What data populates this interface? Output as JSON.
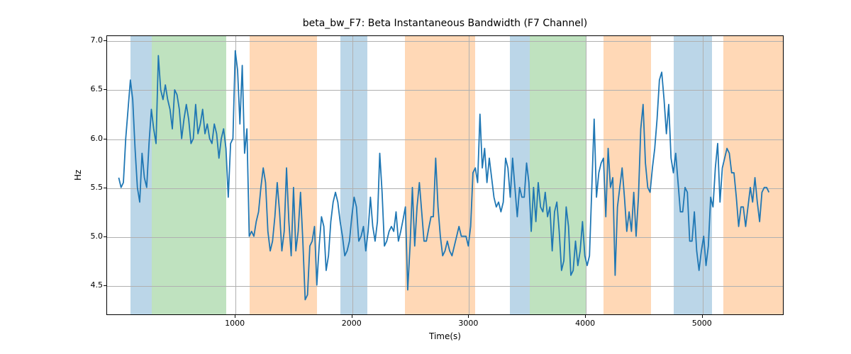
{
  "chart_data": {
    "type": "line",
    "title": "beta_bw_F7: Beta Instantaneous Bandwidth (F7 Channel)",
    "xlabel": "Time(s)",
    "ylabel": "Hz",
    "xlim": [
      -100,
      5700
    ],
    "ylim": [
      4.2,
      7.05
    ],
    "xticks": [
      1000,
      2000,
      3000,
      4000,
      5000
    ],
    "yticks": [
      4.5,
      5.0,
      5.5,
      6.0,
      6.5,
      7.0
    ],
    "background_spans": [
      {
        "x0": 100,
        "x1": 280,
        "color": "#1f77b4"
      },
      {
        "x0": 280,
        "x1": 920,
        "color": "#2ca02c"
      },
      {
        "x0": 1120,
        "x1": 1700,
        "color": "#ff7f0e"
      },
      {
        "x0": 1900,
        "x1": 2130,
        "color": "#1f77b4"
      },
      {
        "x0": 2450,
        "x1": 3050,
        "color": "#ff7f0e"
      },
      {
        "x0": 3350,
        "x1": 3520,
        "color": "#1f77b4"
      },
      {
        "x0": 3520,
        "x1": 4000,
        "color": "#2ca02c"
      },
      {
        "x0": 4150,
        "x1": 4560,
        "color": "#ff7f0e"
      },
      {
        "x0": 4750,
        "x1": 5080,
        "color": "#1f77b4"
      },
      {
        "x0": 5180,
        "x1": 5700,
        "color": "#ff7f0e"
      }
    ],
    "series": [
      {
        "name": "beta_bw_F7",
        "color": "#1f77b4",
        "x": [
          0,
          20,
          40,
          60,
          80,
          100,
          120,
          140,
          160,
          180,
          200,
          220,
          240,
          260,
          280,
          300,
          320,
          340,
          360,
          380,
          400,
          420,
          440,
          460,
          480,
          500,
          520,
          540,
          560,
          580,
          600,
          620,
          640,
          660,
          680,
          700,
          720,
          740,
          760,
          780,
          800,
          820,
          840,
          860,
          880,
          900,
          920,
          940,
          960,
          980,
          1000,
          1020,
          1040,
          1060,
          1080,
          1100,
          1120,
          1140,
          1160,
          1180,
          1200,
          1220,
          1240,
          1260,
          1280,
          1300,
          1320,
          1340,
          1360,
          1380,
          1400,
          1420,
          1440,
          1460,
          1480,
          1500,
          1520,
          1540,
          1560,
          1580,
          1600,
          1620,
          1640,
          1660,
          1680,
          1700,
          1720,
          1740,
          1760,
          1780,
          1800,
          1820,
          1840,
          1860,
          1880,
          1900,
          1920,
          1940,
          1960,
          1980,
          2000,
          2020,
          2040,
          2060,
          2080,
          2100,
          2120,
          2140,
          2160,
          2180,
          2200,
          2220,
          2240,
          2260,
          2280,
          2300,
          2320,
          2340,
          2360,
          2380,
          2400,
          2420,
          2440,
          2460,
          2480,
          2500,
          2520,
          2540,
          2560,
          2580,
          2600,
          2620,
          2640,
          2660,
          2680,
          2700,
          2720,
          2740,
          2760,
          2780,
          2800,
          2820,
          2840,
          2860,
          2880,
          2900,
          2920,
          2940,
          2960,
          2980,
          3000,
          3020,
          3040,
          3060,
          3080,
          3100,
          3120,
          3140,
          3160,
          3180,
          3200,
          3220,
          3240,
          3260,
          3280,
          3300,
          3320,
          3340,
          3360,
          3380,
          3400,
          3420,
          3440,
          3460,
          3480,
          3500,
          3520,
          3540,
          3560,
          3580,
          3600,
          3620,
          3640,
          3660,
          3680,
          3700,
          3720,
          3740,
          3760,
          3780,
          3800,
          3820,
          3840,
          3860,
          3880,
          3900,
          3920,
          3940,
          3960,
          3980,
          4000,
          4020,
          4040,
          4060,
          4080,
          4100,
          4120,
          4140,
          4160,
          4180,
          4200,
          4220,
          4240,
          4260,
          4280,
          4300,
          4320,
          4340,
          4360,
          4380,
          4400,
          4420,
          4440,
          4460,
          4480,
          4500,
          4520,
          4540,
          4560,
          4580,
          4600,
          4620,
          4640,
          4660,
          4680,
          4700,
          4720,
          4740,
          4760,
          4780,
          4800,
          4820,
          4840,
          4860,
          4880,
          4900,
          4920,
          4940,
          4960,
          4980,
          5000,
          5020,
          5040,
          5060,
          5080,
          5100,
          5120,
          5140,
          5160,
          5180,
          5200,
          5220,
          5240,
          5260,
          5280,
          5300,
          5320,
          5340,
          5360,
          5380,
          5400,
          5420,
          5440,
          5460,
          5480,
          5500,
          5520,
          5540,
          5560,
          5580,
          5600
        ],
        "y": [
          5.6,
          5.5,
          5.55,
          6.0,
          6.3,
          6.6,
          6.4,
          5.9,
          5.5,
          5.35,
          5.85,
          5.6,
          5.5,
          5.95,
          6.3,
          6.1,
          5.95,
          6.85,
          6.5,
          6.4,
          6.55,
          6.4,
          6.3,
          6.1,
          6.5,
          6.45,
          6.3,
          6.0,
          6.2,
          6.35,
          6.2,
          5.95,
          6.0,
          6.35,
          6.05,
          6.15,
          6.3,
          6.05,
          6.15,
          6.0,
          5.95,
          6.15,
          6.05,
          5.8,
          6.0,
          6.1,
          5.9,
          5.4,
          5.95,
          6.0,
          6.9,
          6.7,
          6.15,
          6.75,
          5.85,
          6.1,
          5.0,
          5.05,
          5.0,
          5.15,
          5.25,
          5.5,
          5.7,
          5.55,
          5.05,
          4.85,
          4.95,
          5.2,
          5.55,
          5.25,
          4.85,
          5.05,
          5.7,
          5.15,
          4.8,
          5.5,
          4.85,
          5.05,
          5.45,
          4.95,
          4.35,
          4.4,
          4.9,
          4.95,
          5.1,
          4.5,
          4.9,
          5.2,
          5.1,
          4.65,
          4.8,
          5.15,
          5.35,
          5.45,
          5.35,
          5.15,
          5.0,
          4.8,
          4.85,
          4.95,
          5.2,
          5.4,
          5.3,
          4.95,
          5.0,
          5.1,
          4.85,
          5.05,
          5.4,
          5.1,
          4.95,
          5.15,
          5.85,
          5.45,
          4.9,
          4.95,
          5.05,
          5.1,
          5.05,
          5.25,
          4.95,
          5.05,
          5.17,
          5.3,
          4.45,
          4.9,
          5.5,
          4.9,
          5.3,
          5.55,
          5.25,
          4.95,
          4.95,
          5.08,
          5.2,
          5.2,
          5.8,
          5.3,
          5.0,
          4.8,
          4.85,
          4.95,
          4.85,
          4.8,
          4.9,
          5.0,
          5.1,
          5.0,
          5.0,
          5.0,
          4.9,
          5.1,
          5.65,
          5.7,
          5.55,
          6.25,
          5.7,
          5.9,
          5.55,
          5.8,
          5.6,
          5.4,
          5.3,
          5.35,
          5.25,
          5.35,
          5.8,
          5.7,
          5.4,
          5.8,
          5.5,
          5.2,
          5.5,
          5.4,
          5.4,
          5.75,
          5.55,
          5.05,
          5.5,
          5.15,
          5.55,
          5.3,
          5.25,
          5.45,
          5.2,
          5.3,
          4.85,
          5.25,
          5.35,
          5.05,
          4.65,
          4.75,
          5.3,
          5.1,
          4.6,
          4.65,
          4.95,
          4.7,
          4.85,
          5.15,
          4.8,
          4.7,
          4.8,
          5.5,
          6.2,
          5.4,
          5.65,
          5.75,
          5.8,
          5.2,
          5.9,
          5.5,
          5.6,
          4.6,
          5.3,
          5.5,
          5.7,
          5.4,
          5.05,
          5.25,
          5.05,
          5.45,
          5.0,
          5.4,
          6.1,
          6.35,
          5.75,
          5.5,
          5.45,
          5.7,
          5.9,
          6.2,
          6.6,
          6.68,
          6.4,
          6.05,
          6.35,
          5.8,
          5.65,
          5.85,
          5.55,
          5.25,
          5.25,
          5.5,
          5.45,
          4.95,
          4.95,
          5.25,
          4.85,
          4.65,
          4.85,
          5.0,
          4.7,
          4.9,
          5.4,
          5.3,
          5.7,
          5.95,
          5.35,
          5.7,
          5.8,
          5.9,
          5.85,
          5.65,
          5.65,
          5.4,
          5.1,
          5.3,
          5.3,
          5.1,
          5.3,
          5.5,
          5.35,
          5.6,
          5.35,
          5.15,
          5.45,
          5.5,
          5.5,
          5.45
        ]
      }
    ]
  }
}
